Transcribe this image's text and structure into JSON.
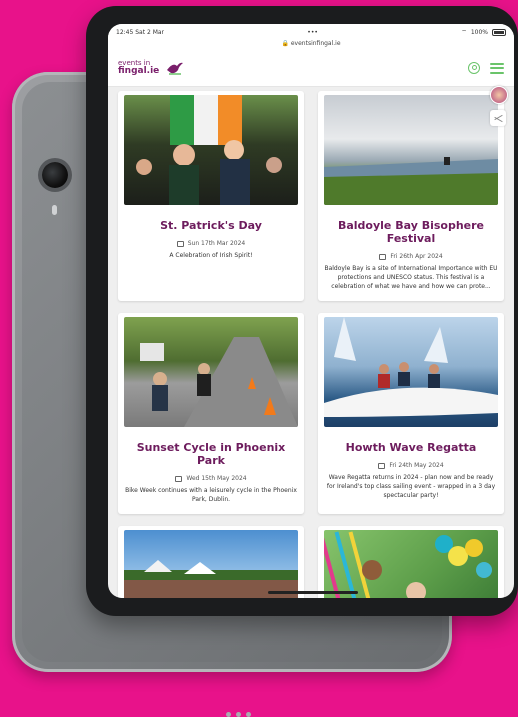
{
  "device": {
    "status_time": "12:45",
    "status_date": "Sat 2 Mar",
    "status_dots": "•••",
    "battery_text": "100%",
    "url": "eventsinfingal.ie"
  },
  "header": {
    "logo_line1": "events in",
    "logo_line2": "fingal.ie"
  },
  "events": [
    {
      "title": "St. Patrick's Day",
      "date": "Sun 17th Mar 2024",
      "description": "A Celebration of Irish Spirit!"
    },
    {
      "title": "Baldoyle Bay Bisophere Festival",
      "date": "Fri 26th Apr 2024",
      "description": "Baldoyle Bay is a site of International Importance with EU protections and UNESCO status. This festival is a celebration of what we have and how we can prote..."
    },
    {
      "title": "Sunset Cycle in Phoenix Park",
      "date": "Wed 15th May 2024",
      "description": "Bike Week continues with a leisurely cycle in the Phoenix Park, Dublin."
    },
    {
      "title": "Howth Wave Regatta",
      "date": "Fri 24th May 2024",
      "description": "Wave Regatta returns in 2024 - plan now and be ready for Ireland's top class sailing event - wrapped in a 3 day spectacular party!"
    }
  ],
  "colors": {
    "background": "#e8128a",
    "title_purple": "#6d1c5d",
    "accent_green": "#6ac46a"
  }
}
